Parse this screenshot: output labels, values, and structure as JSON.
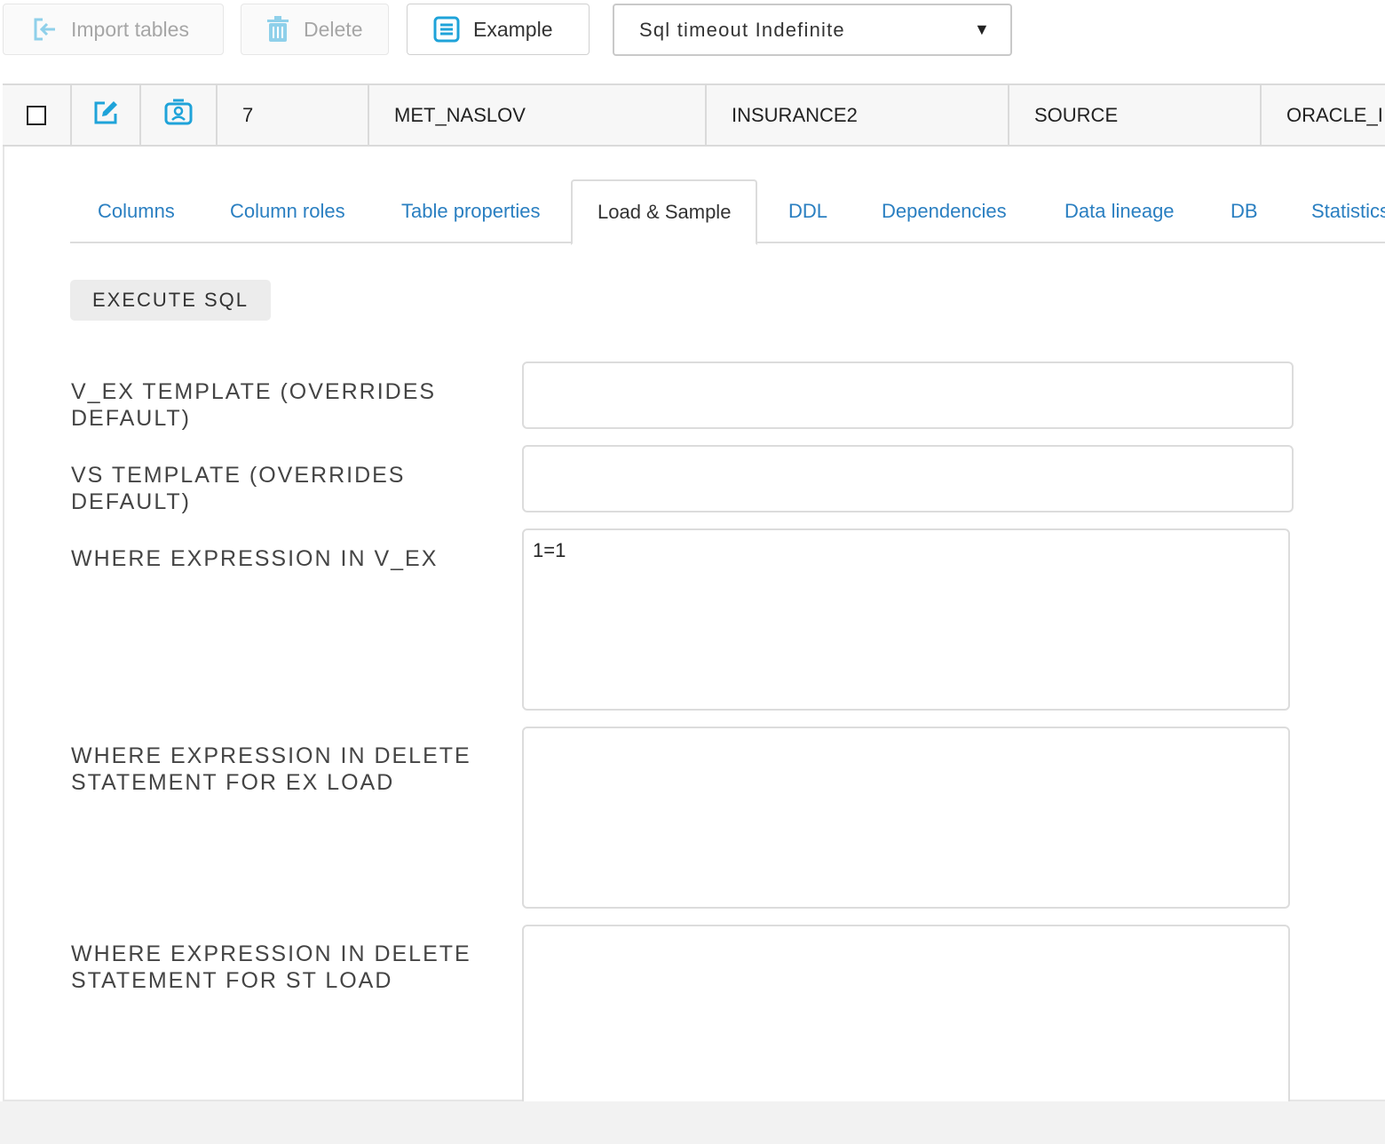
{
  "toolbar": {
    "import_label": "Import tables",
    "delete_label": "Delete",
    "example_label": "Example",
    "timeout_select": "Sql timeout Indefinite"
  },
  "row": {
    "number": "7",
    "name": "MET_NASLOV",
    "schema": "INSURANCE2",
    "type": "SOURCE",
    "connection": "ORACLE_I"
  },
  "tabs": [
    "Columns",
    "Column roles",
    "Table properties",
    "Load & Sample",
    "DDL",
    "Dependencies",
    "Data lineage",
    "DB",
    "Statistics"
  ],
  "active_tab": "Load & Sample",
  "execute_label": "EXECUTE SQL",
  "fields": {
    "vex_template_label": "V_EX TEMPLATE (OVERRIDES DEFAULT)",
    "vex_template_value": "",
    "vs_template_label": "VS TEMPLATE (OVERRIDES DEFAULT)",
    "vs_template_value": "",
    "where_vex_label": "WHERE EXPRESSION IN V_EX",
    "where_vex_value": "1=1",
    "where_delete_ex_label": "WHERE EXPRESSION IN DELETE STATEMENT FOR EX LOAD",
    "where_delete_ex_value": "",
    "where_delete_st_label": "WHERE EXPRESSION IN DELETE STATEMENT FOR ST LOAD",
    "where_delete_st_value": ""
  },
  "colors": {
    "accent": "#1fa3d9",
    "tab_link": "#2a7fc1",
    "disabled_text": "#a6a6a6"
  },
  "icons": {
    "import": "import-icon",
    "delete": "trash-icon",
    "example": "document-icon",
    "edit": "edit-icon",
    "profile": "user-card-icon"
  }
}
